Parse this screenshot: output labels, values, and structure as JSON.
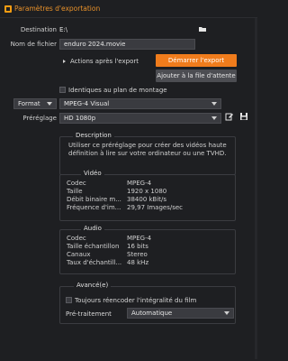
{
  "panel": {
    "title": "Paramètres d'exportation"
  },
  "destination": {
    "label": "Destination",
    "value": "E:\\"
  },
  "filename": {
    "label": "Nom de fichier",
    "value": "enduro 2024.movie"
  },
  "actions": {
    "after_export_label": "Actions après l'export",
    "start_export": "Démarrer l'export",
    "add_queue": "Ajouter à la file d'attente"
  },
  "identical": {
    "label": "Identiques au plan de montage"
  },
  "format": {
    "label": "Format",
    "value": "MPEG-4 Visual"
  },
  "preset": {
    "label": "Préréglage",
    "value": "HD 1080p"
  },
  "description": {
    "title": "Description",
    "lines": [
      "Utiliser ce préréglage pour créer des vidéos haute",
      "définition à lire sur votre ordinateur ou une TVHD."
    ]
  },
  "video": {
    "title": "Vidéo",
    "rows": [
      {
        "key": "Codec",
        "value": "MPEG-4"
      },
      {
        "key": "Taille",
        "value": "1920 x 1080"
      },
      {
        "key": "Débit binaire m...",
        "value": "38400 kBit/s"
      },
      {
        "key": "Fréquence d'im...",
        "value": "29,97 Images/sec"
      }
    ]
  },
  "audio": {
    "title": "Audio",
    "rows": [
      {
        "key": "Codec",
        "value": "MPEG-4"
      },
      {
        "key": "Taille échantillon",
        "value": "16 bits"
      },
      {
        "key": "Canaux",
        "value": "Stereo"
      },
      {
        "key": "Taux d'échantill...",
        "value": "48 kHz"
      }
    ]
  },
  "advanced": {
    "title": "Avancé(e)",
    "reencode_label": "Toujours réencoder l'intégralité du film",
    "pretreatment_label": "Pré-traitement",
    "pretreatment_value": "Automatique"
  },
  "colors": {
    "accent": "#f07c1c",
    "background": "#1e1f22",
    "field": "#3a3b40"
  }
}
